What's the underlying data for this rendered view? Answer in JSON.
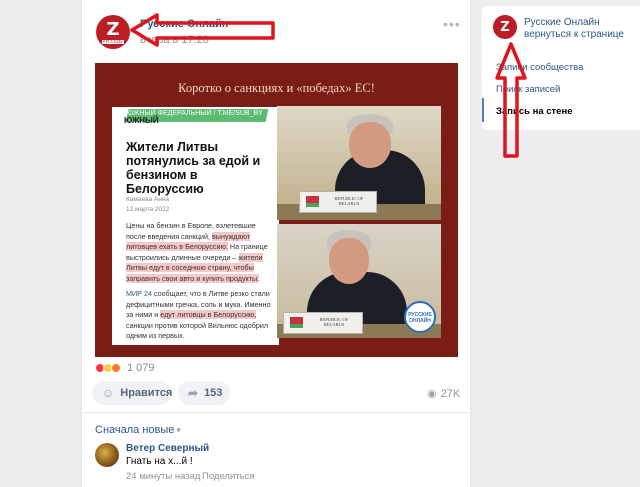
{
  "post": {
    "author": "Русские Онлайн",
    "date": "вчера в 17:20",
    "menu_icon": "more-horizontal-icon",
    "image": {
      "title": "Коротко о санкциях  и «победах» ЕС!",
      "article": {
        "ribbon": "ЮЖНЫЙ ФЕДЕРАЛЬНЫЙ / T.ME/SUB_BY",
        "region": "ЮЖНЫЙ",
        "headline": "Жители Литвы потянулись за едой и бензином в Белоруссию",
        "author": "Камаева Анна",
        "date": "12 марта 2022",
        "p1_a": "Цены на бензин в Европе, взлетевшие после введения санкций,",
        "p1_hl1": "вынуждают литовцев ехать в Белоруссию.",
        "p1_b": "На границе выстроились длинные очереди –",
        "p1_hl2": "жители Литвы едут в соседнюю страну, чтобы заправить свои авто и купить продукты.",
        "p2_link": "МИР 24",
        "p2_a": "сообщает, что в Литве резко стали дефицитными гречка, соль и мука. Именно за ними и",
        "p2_hl": "едут литовцы в Белоруссию,",
        "p2_b": "санкции против которой Вильнюс одобрил одним из первых."
      },
      "plate_text": "REPUBLIC OF BELARUS",
      "badge_text": "РУССКИЕ ОНЛАЙН"
    },
    "reactions_count": "1 079",
    "like_label": "Нравится",
    "share_count": "153",
    "views": "27K",
    "sort_label": "Сначала новые",
    "comment": {
      "author": "Ветер Северный",
      "text": "Гнать на х...й !",
      "time": "24 минуты назад",
      "share_label": "Поделиться"
    }
  },
  "right_card": {
    "name": "Русские Онлайн",
    "back_label": "вернуться к странице",
    "items": [
      "Записи сообщества",
      "Поиск записей",
      "Запись на стене"
    ],
    "active_index": 2
  },
  "colors": {
    "link": "#2a5885",
    "arrow": "#e0141d",
    "brand_red": "#b91f24"
  }
}
